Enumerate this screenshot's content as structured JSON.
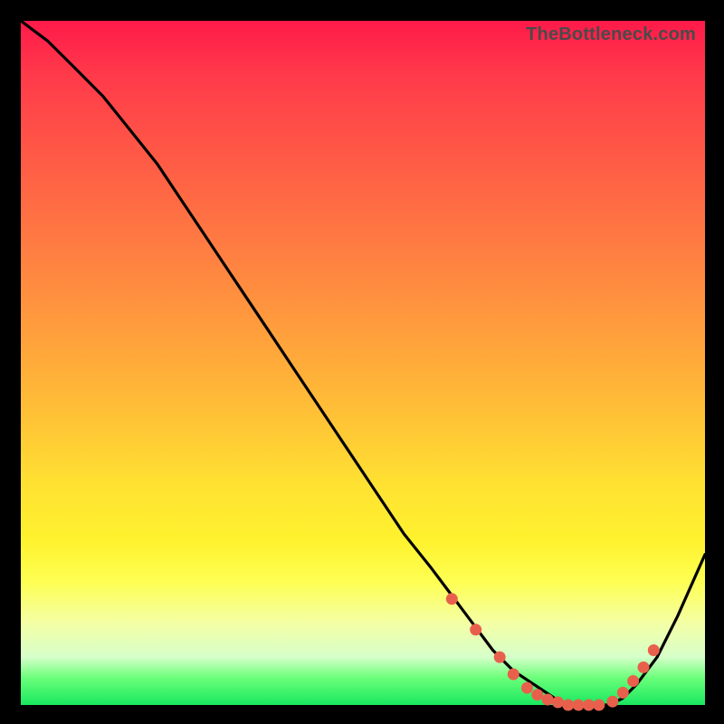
{
  "watermark": "TheBottleneck.com",
  "chart_data": {
    "type": "line",
    "title": "",
    "xlabel": "",
    "ylabel": "",
    "xlim": [
      0,
      100
    ],
    "ylim": [
      0,
      100
    ],
    "grid": false,
    "legend": false,
    "series": [
      {
        "name": "bottleneck-curve",
        "x": [
          0,
          4,
          8,
          12,
          16,
          20,
          24,
          28,
          32,
          36,
          40,
          44,
          48,
          52,
          56,
          60,
          63,
          66,
          69,
          72,
          75,
          78,
          80,
          82,
          84,
          86,
          88,
          90,
          93,
          96,
          100
        ],
        "y": [
          100,
          97,
          93,
          89,
          84,
          79,
          73,
          67,
          61,
          55,
          49,
          43,
          37,
          31,
          25,
          20,
          16,
          12,
          8,
          5,
          3,
          1,
          0,
          0,
          0,
          0,
          1,
          3,
          7,
          13,
          22
        ]
      }
    ],
    "markers": {
      "name": "highlight-points",
      "x": [
        63,
        66.5,
        70,
        72,
        74,
        75.5,
        77,
        78.5,
        80,
        81.5,
        83,
        84.5,
        86.5,
        88,
        89.5,
        91,
        92.5
      ],
      "y": [
        15.5,
        11,
        7,
        4.5,
        2.5,
        1.5,
        0.8,
        0.4,
        0,
        0,
        0,
        0,
        0.5,
        1.8,
        3.5,
        5.5,
        8
      ]
    },
    "gradient_stops": [
      {
        "pos": 0.0,
        "color": "#ff1a4a"
      },
      {
        "pos": 0.2,
        "color": "#ff5a46"
      },
      {
        "pos": 0.46,
        "color": "#ffa03c"
      },
      {
        "pos": 0.68,
        "color": "#ffe232"
      },
      {
        "pos": 0.82,
        "color": "#feff53"
      },
      {
        "pos": 0.93,
        "color": "#d6ffc9"
      },
      {
        "pos": 1.0,
        "color": "#18e85f"
      }
    ]
  }
}
